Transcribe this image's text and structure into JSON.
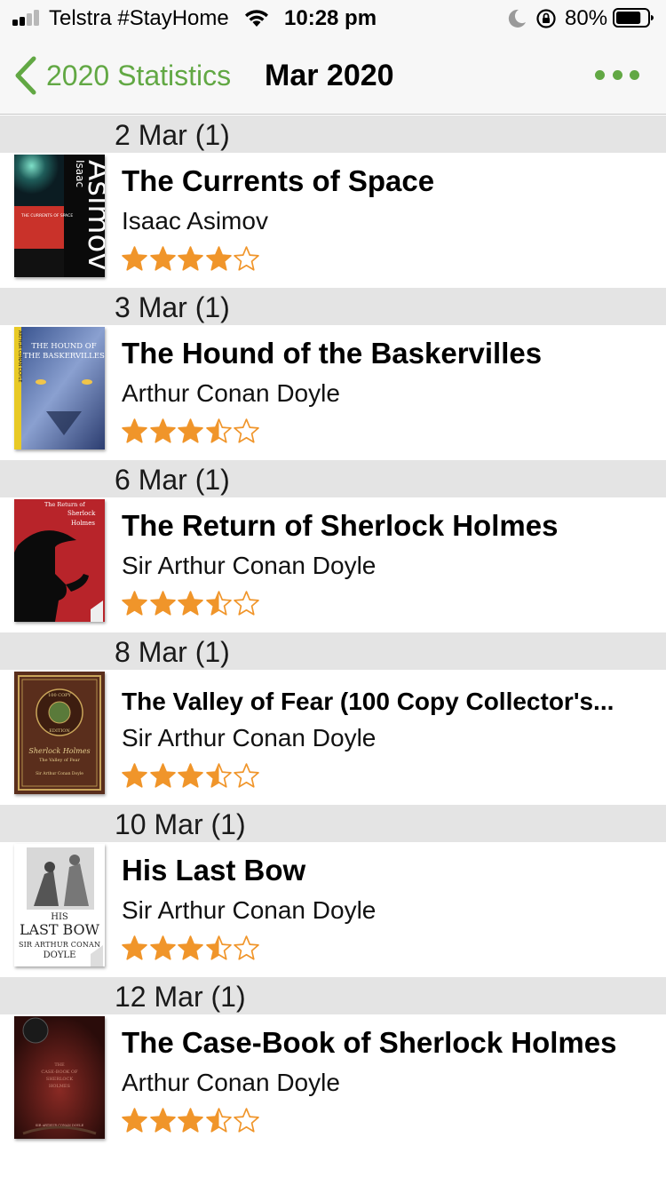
{
  "status_bar": {
    "carrier": "Telstra #StayHome",
    "time": "10:28 pm",
    "battery_percent": "80%",
    "signal_bars": 2,
    "battery_level": 0.8
  },
  "nav": {
    "back_label": "2020 Statistics",
    "title": "Mar 2020",
    "accent_color": "#62a844",
    "back_icon": "chevron-left-icon",
    "more_icon": "ellipsis-icon"
  },
  "star_color": "#f0952a",
  "sections": [
    {
      "header": "2 Mar (1)",
      "book": {
        "title": "The Currents of Space",
        "author": "Isaac Asimov",
        "rating": 4,
        "cover": "currents"
      }
    },
    {
      "header": "3 Mar (1)",
      "book": {
        "title": "The Hound of the Baskervilles",
        "author": "Arthur Conan Doyle",
        "rating": 3.5,
        "cover": "hound"
      }
    },
    {
      "header": "6 Mar (1)",
      "book": {
        "title": "The Return of Sherlock Holmes",
        "author": "Sir Arthur Conan Doyle",
        "rating": 3.5,
        "cover": "return"
      }
    },
    {
      "header": "8 Mar (1)",
      "book": {
        "title": "The Valley of Fear (100 Copy Collector's...",
        "author": "Sir Arthur Conan Doyle",
        "rating": 3.5,
        "cover": "valley"
      }
    },
    {
      "header": "10 Mar (1)",
      "book": {
        "title": "His Last Bow",
        "author": "Sir Arthur Conan Doyle",
        "rating": 3.5,
        "cover": "lastbow"
      }
    },
    {
      "header": "12 Mar (1)",
      "book": {
        "title": "The Case-Book of Sherlock Holmes",
        "author": "Arthur Conan Doyle",
        "rating": 3.5,
        "cover": "casebook"
      }
    }
  ],
  "covers": {
    "currents": {
      "author_first": "Isaac",
      "author_last": "Asimov",
      "title": "THE CURRENTS OF SPACE"
    },
    "hound": {
      "title_line1": "THE HOUND OF",
      "title_line2": "THE BASKERVILLES",
      "spine": "ARTHUR CONAN DOYLE"
    },
    "return": {
      "title_line1": "The Return of",
      "title_line2": "Sherlock",
      "title_line3": "Holmes"
    },
    "valley": {
      "badge_top": "100 COPY",
      "badge_bottom": "EDITION",
      "title_line1": "Sherlock Holmes",
      "title_line2": "The Valley of Fear",
      "author": "Sir Arthur Conan Doyle"
    },
    "lastbow": {
      "line1": "HIS",
      "line2": "LAST BOW",
      "line3": "SIR ARTHUR CONAN",
      "line4": "DOYLE"
    },
    "casebook": {
      "line1": "THE",
      "line2": "CASE-BOOK OF",
      "line3": "SHERLOCK",
      "line4": "HOLMES",
      "author": "SIR ARTHUR CONAN DOYLE"
    }
  }
}
